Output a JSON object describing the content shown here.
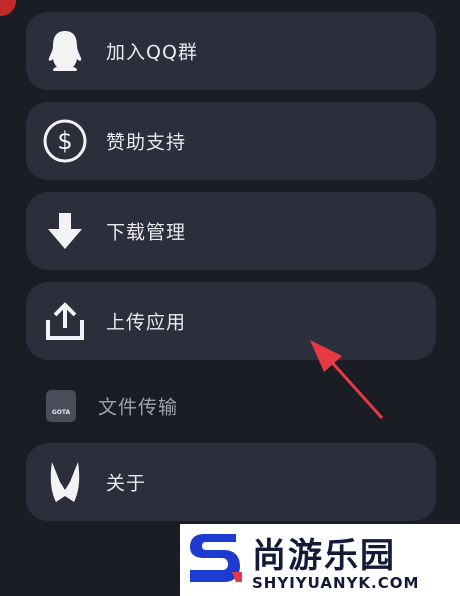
{
  "menu": {
    "items": [
      {
        "label": "加入QQ群",
        "icon": "qq-penguin-icon"
      },
      {
        "label": "赞助支持",
        "icon": "dollar-circle-icon"
      },
      {
        "label": "下载管理",
        "icon": "download-arrow-icon"
      },
      {
        "label": "上传应用",
        "icon": "upload-icon"
      },
      {
        "label": "文件传输",
        "icon": "file-transfer-app-icon",
        "icon_text": "GOTA"
      },
      {
        "label": "关于",
        "icon": "about-logo-icon"
      }
    ]
  },
  "watermark": {
    "title": "尚游乐园",
    "url": "SHYIYUANYK.COM"
  },
  "colors": {
    "background": "#1b1d25",
    "card": "#2b2e3b",
    "annotation_arrow": "#e83a45"
  }
}
